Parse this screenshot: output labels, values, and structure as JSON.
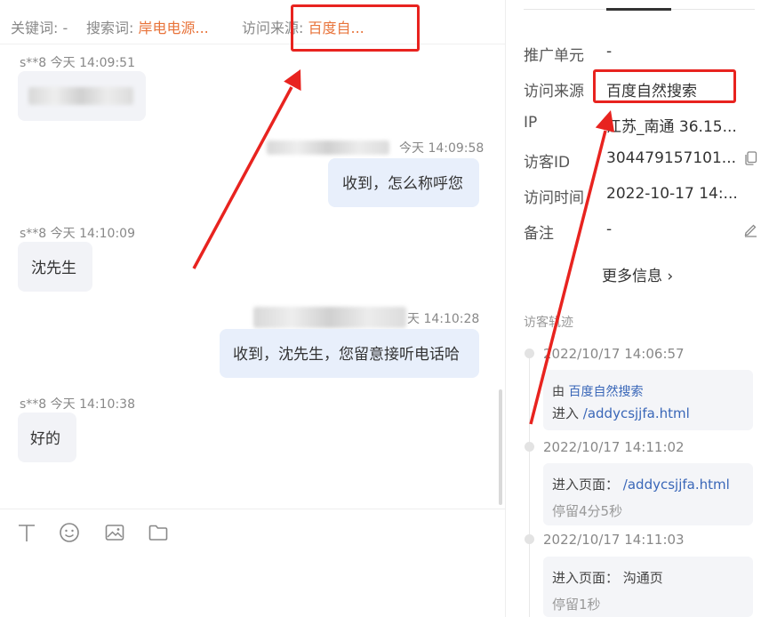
{
  "top_bar": {
    "keyword_label": "关键词: ",
    "keyword_value": "-",
    "search_label": "搜索词: ",
    "search_value": "岸电电源...",
    "source_label": "访问来源: ",
    "source_value": "百度自..."
  },
  "chat": {
    "messages": [
      {
        "direction": "in",
        "sender": "s**8",
        "time": "今天 14:09:51",
        "text": ""
      },
      {
        "direction": "out",
        "time": "今天 14:09:58",
        "text": "收到，怎么称呼您"
      },
      {
        "direction": "in",
        "sender": "s**8",
        "time": "今天 14:10:09",
        "text": "沈先生"
      },
      {
        "direction": "out",
        "time": "天 14:10:28",
        "text": "收到，沈先生，您留意接听电话哈"
      },
      {
        "direction": "in",
        "sender": "s**8",
        "time": "今天 14:10:38",
        "text": "好的"
      }
    ]
  },
  "toolbar": {
    "icons": [
      "text-icon",
      "emoji-icon",
      "image-icon",
      "folder-icon"
    ]
  },
  "visitor_info": {
    "fields": [
      {
        "label": "推广单元",
        "value": "-"
      },
      {
        "label": "访问来源",
        "value": "百度自然搜索"
      },
      {
        "label": "IP",
        "value": "江苏_南通 36.15..."
      },
      {
        "label": "访客ID",
        "value": "304479157101..."
      },
      {
        "label": "访问时间",
        "value": "2022-10-17 14:..."
      },
      {
        "label": "备注",
        "value": "-"
      }
    ],
    "more_info": "更多信息 ›"
  },
  "trail": {
    "title": "访客轨迹",
    "entries": [
      {
        "time": "2022/10/17 14:06:57",
        "from_prefix": "由 ",
        "from_link": "百度自然搜索",
        "enter_prefix": "进入 ",
        "enter_link": "/addycsjjfa.html"
      },
      {
        "time": "2022/10/17 14:11:02",
        "page_label": "进入页面：",
        "page_link": "/addycsjjfa.html",
        "stay": "停留4分5秒"
      },
      {
        "time": "2022/10/17 14:11:03",
        "page_label": "进入页面：",
        "page_value": "沟通页",
        "stay": "停留1秒"
      }
    ]
  },
  "colors": {
    "annotation_red": "#e8231f",
    "highlight_orange": "#e8743b",
    "link_blue": "#3a67b8",
    "bubble_out": "#e8effb",
    "bubble_in": "#f2f3f7"
  }
}
